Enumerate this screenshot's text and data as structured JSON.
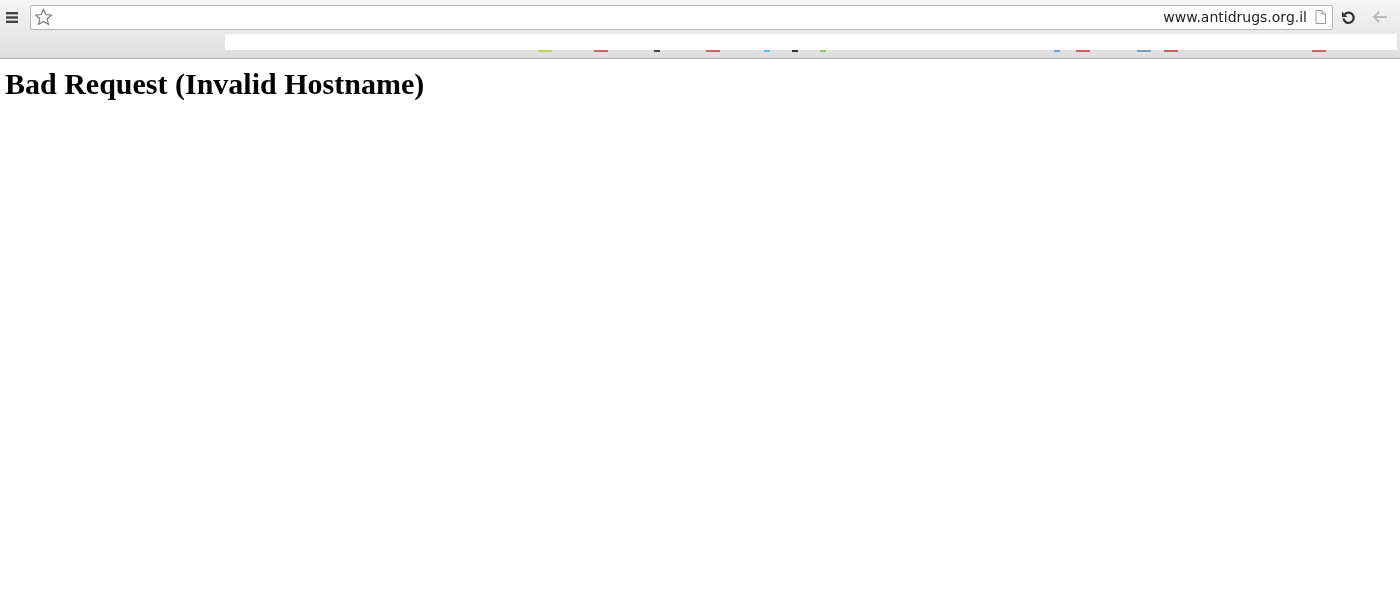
{
  "address_bar": {
    "url": "www.antidrugs.org.il"
  },
  "page": {
    "heading": "Bad Request (Invalid Hostname)"
  }
}
